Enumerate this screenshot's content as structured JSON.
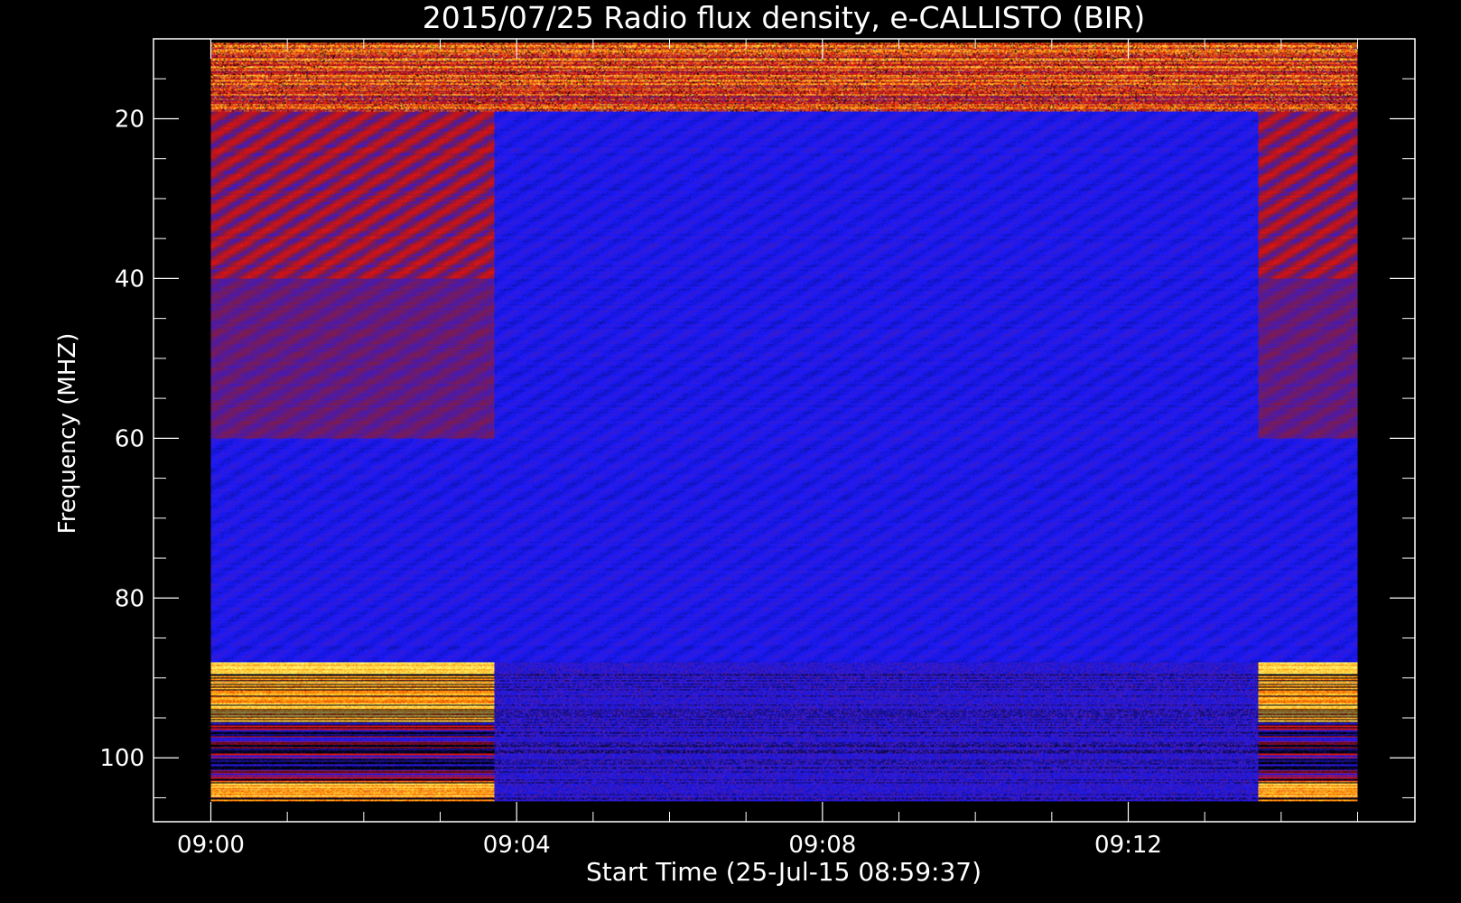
{
  "chart_data": {
    "type": "heatmap",
    "title": "2015/07/25  Radio flux density, e-CALLISTO (BIR)",
    "xlabel": "Start Time (25-Jul-15 08:59:37)",
    "ylabel": "Frequency (MHZ)",
    "x_tick_labels": [
      "09:00",
      "09:04",
      "09:08",
      "09:12"
    ],
    "x_ticks_minutes": [
      0,
      4,
      8,
      12
    ],
    "y_tick_labels": [
      "20",
      "40",
      "60",
      "80",
      "100"
    ],
    "y_ticks": [
      20,
      40,
      60,
      80,
      100
    ],
    "xlim_minutes": [
      -0.75,
      15.75
    ],
    "ylim": [
      10,
      108
    ],
    "y_inverted": true,
    "data_time_range_minutes": [
      0,
      15
    ],
    "data_freq_range": [
      10.5,
      105.5
    ],
    "colormap": [
      "#000000",
      "#1a1aff",
      "#8a1a3a",
      "#e01010",
      "#ffa000",
      "#ffff80"
    ],
    "segments": [
      {
        "label": "09:00–09:03.7",
        "time_range_minutes": [
          0,
          3.7
        ],
        "bands": [
          {
            "freq": [
              10.5,
              19
            ],
            "level": "high"
          },
          {
            "freq": [
              19,
              40
            ],
            "level": "medium"
          },
          {
            "freq": [
              40,
              60
            ],
            "level": "low-medium"
          },
          {
            "freq": [
              60,
              88
            ],
            "level": "low"
          },
          {
            "freq": [
              88,
              95.5
            ],
            "level": "very high"
          },
          {
            "freq": [
              95.5,
              103
            ],
            "level": "mixed"
          },
          {
            "freq": [
              103,
              105
            ],
            "level": "very high"
          }
        ]
      },
      {
        "label": "09:03.7–09:13.7",
        "time_range_minutes": [
          3.7,
          13.7
        ],
        "bands": [
          {
            "freq": [
              10.5,
              19
            ],
            "level": "high"
          },
          {
            "freq": [
              19,
              88
            ],
            "level": "low"
          },
          {
            "freq": [
              88,
              105.5
            ],
            "level": "low-mixed"
          }
        ]
      },
      {
        "label": "09:13.7–09:15",
        "time_range_minutes": [
          13.7,
          15
        ],
        "bands": [
          {
            "freq": [
              10.5,
              19
            ],
            "level": "high"
          },
          {
            "freq": [
              19,
              40
            ],
            "level": "medium"
          },
          {
            "freq": [
              40,
              60
            ],
            "level": "low-medium"
          },
          {
            "freq": [
              60,
              88
            ],
            "level": "low"
          },
          {
            "freq": [
              88,
              95.5
            ],
            "level": "very high"
          },
          {
            "freq": [
              95.5,
              103
            ],
            "level": "mixed"
          },
          {
            "freq": [
              103,
              105
            ],
            "level": "very high"
          }
        ]
      }
    ]
  }
}
